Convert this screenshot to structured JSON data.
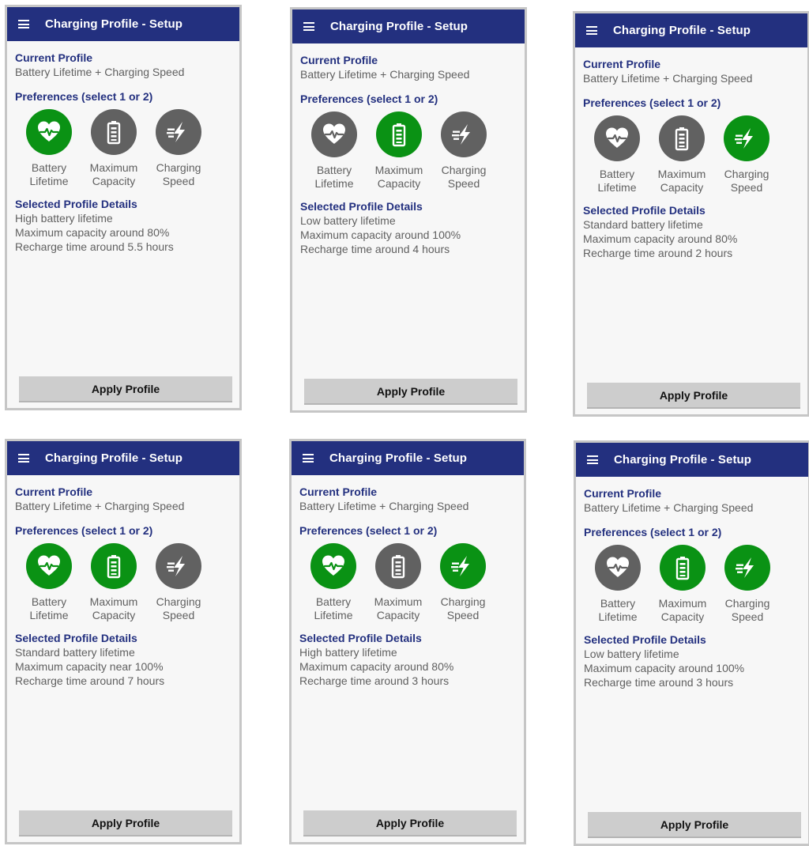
{
  "screens": [
    {
      "app_title": "Charging Profile - Setup",
      "current_profile_label": "Current Profile",
      "current_profile_value": "Battery Lifetime + Charging Speed",
      "preferences_label": "Preferences (select 1 or 2)",
      "options": [
        {
          "line1": "Battery",
          "line2": "Lifetime",
          "icon": "heart-pulse-icon",
          "selected": true
        },
        {
          "line1": "Maximum",
          "line2": "Capacity",
          "icon": "battery-icon",
          "selected": false
        },
        {
          "line1": "Charging",
          "line2": "Speed",
          "icon": "fast-charge-icon",
          "selected": false
        }
      ],
      "details_label": "Selected Profile Details",
      "details": [
        "High battery lifetime",
        "Maximum capacity around 80%",
        "Recharge time around 5.5 hours"
      ],
      "apply_label": "Apply Profile"
    },
    {
      "app_title": "Charging Profile - Setup",
      "current_profile_label": "Current Profile",
      "current_profile_value": "Battery Lifetime + Charging Speed",
      "preferences_label": "Preferences (select 1 or 2)",
      "options": [
        {
          "line1": "Battery",
          "line2": "Lifetime",
          "icon": "heart-pulse-icon",
          "selected": false
        },
        {
          "line1": "Maximum",
          "line2": "Capacity",
          "icon": "battery-icon",
          "selected": true
        },
        {
          "line1": "Charging",
          "line2": "Speed",
          "icon": "fast-charge-icon",
          "selected": false
        }
      ],
      "details_label": "Selected Profile Details",
      "details": [
        "Low battery lifetime",
        "Maximum capacity around 100%",
        "Recharge time around 4 hours"
      ],
      "apply_label": "Apply Profile"
    },
    {
      "app_title": "Charging Profile - Setup",
      "current_profile_label": "Current Profile",
      "current_profile_value": "Battery Lifetime + Charging Speed",
      "preferences_label": "Preferences (select 1 or 2)",
      "options": [
        {
          "line1": "Battery",
          "line2": "Lifetime",
          "icon": "heart-pulse-icon",
          "selected": false
        },
        {
          "line1": "Maximum",
          "line2": "Capacity",
          "icon": "battery-icon",
          "selected": false
        },
        {
          "line1": "Charging",
          "line2": "Speed",
          "icon": "fast-charge-icon",
          "selected": true
        }
      ],
      "details_label": "Selected Profile Details",
      "details": [
        "Standard battery lifetime",
        "Maximum capacity around 80%",
        "Recharge time around 2 hours"
      ],
      "apply_label": "Apply Profile"
    },
    {
      "app_title": "Charging Profile - Setup",
      "current_profile_label": "Current Profile",
      "current_profile_value": "Battery Lifetime + Charging Speed",
      "preferences_label": "Preferences (select 1 or 2)",
      "options": [
        {
          "line1": "Battery",
          "line2": "Lifetime",
          "icon": "heart-pulse-icon",
          "selected": true
        },
        {
          "line1": "Maximum",
          "line2": "Capacity",
          "icon": "battery-icon",
          "selected": true
        },
        {
          "line1": "Charging",
          "line2": "Speed",
          "icon": "fast-charge-icon",
          "selected": false
        }
      ],
      "details_label": "Selected Profile Details",
      "details": [
        "Standard battery lifetime",
        "Maximum capacity near 100%",
        "Recharge time around 7 hours"
      ],
      "apply_label": "Apply Profile"
    },
    {
      "app_title": "Charging Profile - Setup",
      "current_profile_label": "Current Profile",
      "current_profile_value": "Battery Lifetime + Charging Speed",
      "preferences_label": "Preferences (select 1 or 2)",
      "options": [
        {
          "line1": "Battery",
          "line2": "Lifetime",
          "icon": "heart-pulse-icon",
          "selected": true
        },
        {
          "line1": "Maximum",
          "line2": "Capacity",
          "icon": "battery-icon",
          "selected": false
        },
        {
          "line1": "Charging",
          "line2": "Speed",
          "icon": "fast-charge-icon",
          "selected": true
        }
      ],
      "details_label": "Selected Profile Details",
      "details": [
        "High battery lifetime",
        "Maximum capacity around 80%",
        "Recharge time around 3 hours"
      ],
      "apply_label": "Apply Profile"
    },
    {
      "app_title": "Charging Profile - Setup",
      "current_profile_label": "Current Profile",
      "current_profile_value": "Battery Lifetime + Charging Speed",
      "preferences_label": "Preferences (select 1 or 2)",
      "options": [
        {
          "line1": "Battery",
          "line2": "Lifetime",
          "icon": "heart-pulse-icon",
          "selected": false
        },
        {
          "line1": "Maximum",
          "line2": "Capacity",
          "icon": "battery-icon",
          "selected": true
        },
        {
          "line1": "Charging",
          "line2": "Speed",
          "icon": "fast-charge-icon",
          "selected": true
        }
      ],
      "details_label": "Selected Profile Details",
      "details": [
        "Low battery lifetime",
        "Maximum capacity around 100%",
        "Recharge time around 3 hours"
      ],
      "apply_label": "Apply Profile"
    }
  ],
  "colors": {
    "appbar": "#23307f",
    "selected": "#0a9214",
    "unselected": "#616161",
    "section_title": "#23307f"
  }
}
